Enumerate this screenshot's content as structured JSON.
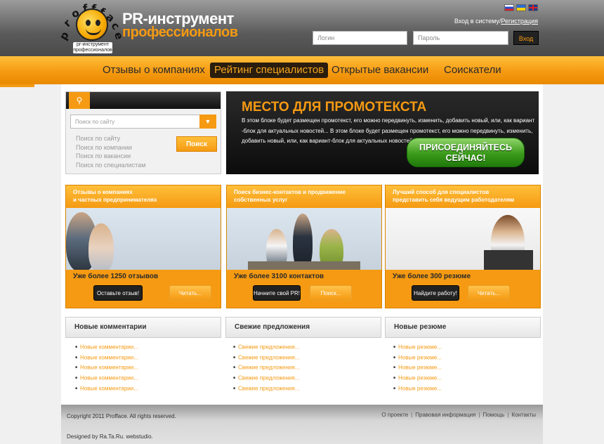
{
  "header": {
    "logo_ring_text": "proffface",
    "logo_sub": "pr-инструмент профессионалов",
    "brand_line1": "PR-инструмент",
    "brand_line2": "профессионалов",
    "login_text": "Вход в систему/",
    "register_link": "Регистрация",
    "login_placeholder": "Логин",
    "password_placeholder": "Пароль",
    "enter_button": "Вход"
  },
  "nav": {
    "items": [
      "Отзывы о компаниях",
      "Рейтинг специалистов",
      "Открытые вакансии",
      "Соискатели"
    ],
    "active_index": 1
  },
  "search": {
    "placeholder": "Поиск по сайту",
    "links": [
      "Поиск по сайту",
      "Поиск по компании",
      "Поиск по вакансии",
      "Поиск по специалистам"
    ],
    "button": "Поиск"
  },
  "promo": {
    "title": "МЕСТО ДЛЯ ПРОМОТЕКСТА",
    "text": "В этом блоке будет размещен промотекст, его можно передвинуть, изменить, добавить новый, или, как вариант -блок для актуальных новостей... В этом блоке будет размещен промотекст, его можно передвинуть, изменить, добавить новый, или, как вариант-блок для актуальных новостей...",
    "button_line1": "ПРИСОЕДИНЯЙТЕСЬ",
    "button_line2": "СЕЙЧАС!"
  },
  "cards": [
    {
      "head_line1": "Отзывы о компаниях",
      "head_line2": "и частных предпринимателях",
      "count": "Уже более 1250 отзывов",
      "dark_button": "Оставьте отзыв!",
      "light_button": "Читать..."
    },
    {
      "head_line1": "Поиск бизнес-контактов и продвижение",
      "head_line2": "собственных услуг",
      "count": "Уже более 3100 контактов",
      "dark_button": "Начните свой PR!",
      "light_button": "Поиск..."
    },
    {
      "head_line1": "Лучший способ для специалистов",
      "head_line2": "представить себя ведущим работодателям",
      "count": "Уже более 300 резюме",
      "dark_button": "Найдите работу!",
      "light_button": "Читать..."
    }
  ],
  "lists": [
    {
      "title": "Новые комментарии",
      "items": [
        "Новые комментарии...",
        "Новые комментарии...",
        "Новые комментарии...",
        "Новые комментарии...",
        "Новые комментарии..."
      ]
    },
    {
      "title": "Свежие предложения",
      "items": [
        "Свежие предложения...",
        "Свежие предложения...",
        "Свежие предложения...",
        "Свежие предложения...",
        "Свежие предложения..."
      ]
    },
    {
      "title": "Новые резюме",
      "items": [
        "Новые резюме...",
        "Новые резюме...",
        "Новые резюме...",
        "Новые резюме...",
        "Новые резюме..."
      ]
    }
  ],
  "footer": {
    "copyright": "Copyright 2011 Profface. All rights reserved.",
    "designed": "Designed by Ra.Ta.Ru. webstudio.",
    "links": [
      "О проекте",
      "Правовая информация",
      "Помощь",
      "Контакты"
    ]
  },
  "colors": {
    "accent": "#f59a12",
    "dark": "#222222",
    "green": "#3a9a1a"
  }
}
